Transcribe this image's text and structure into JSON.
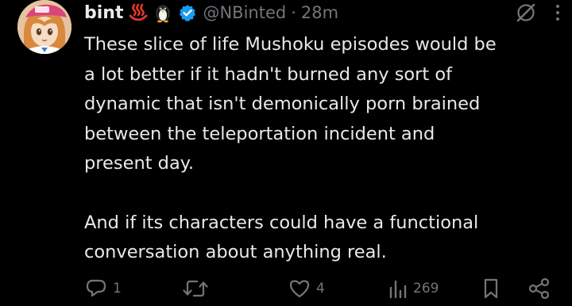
{
  "post": {
    "author": {
      "display_name": "bint",
      "name_emojis": [
        "hot-springs-emoji",
        "penguin-emoji"
      ],
      "verified": true,
      "handle": "@NBinted",
      "separator": "·",
      "timestamp": "28m"
    },
    "text_paragraphs": [
      "These slice of life Mushoku episodes would be\na lot better if it hadn't burned any sort of\ndynamic that isn't demonically porn brained\nbetween the teleportation incident and\npresent day.",
      "And if its characters could have a functional\nconversation about anything real."
    ],
    "actions": {
      "reply_count": "1",
      "repost_count": "",
      "like_count": "4",
      "views_count": "269"
    }
  },
  "colors": {
    "background": "#000000",
    "text": "#e7e9ea",
    "secondary": "#71767b",
    "verified_badge": "#1d9bf0",
    "hot_springs": "#e0382b"
  }
}
